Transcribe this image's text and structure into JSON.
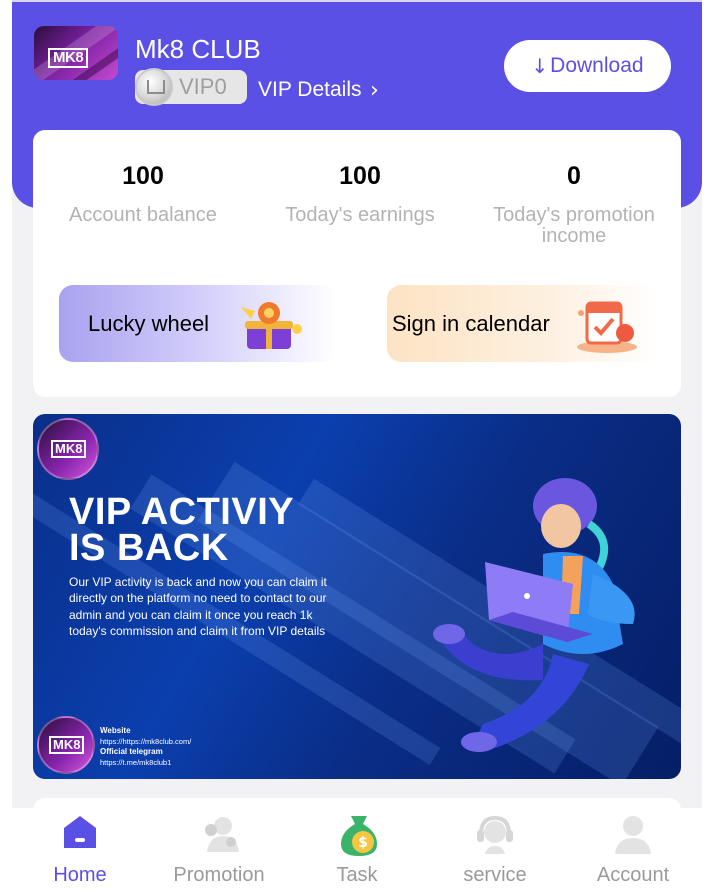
{
  "header": {
    "club_name": "Mk8 CLUB",
    "logo_text": "MK8",
    "vip_level": "VIP0",
    "vip_details": "VIP Details",
    "download_label": "Download",
    "accent_color": "#5b50e6"
  },
  "stats": [
    {
      "value": "100",
      "label": "Account balance"
    },
    {
      "value": "100",
      "label": "Today's earnings"
    },
    {
      "value": "0",
      "label": "Today's promotion income"
    }
  ],
  "shortcuts": {
    "lucky_wheel": "Lucky wheel",
    "sign_in_calendar": "Sign in calendar"
  },
  "banner": {
    "logo_text": "MK8",
    "headline_line1": "VIP ACTIVIY",
    "headline_line2": "IS BACK",
    "body": "Our VIP activity is back and now you can claim it directly on the platform no need to contact to our admin and you can claim it once you reach 1k today's commission and claim it from VIP details",
    "website_label": "Website",
    "website_url": "https://https://mk8club.com/",
    "telegram_label": "Official telegram",
    "telegram_url": "https://t.me/mk8club1"
  },
  "nav": [
    {
      "label": "Home",
      "icon": "home-icon",
      "active": true
    },
    {
      "label": "Promotion",
      "icon": "promotion-icon",
      "active": false
    },
    {
      "label": "Task",
      "icon": "money-bag-icon",
      "active": false
    },
    {
      "label": "service",
      "icon": "headset-icon",
      "active": false
    },
    {
      "label": "Account",
      "icon": "user-icon",
      "active": false
    }
  ]
}
